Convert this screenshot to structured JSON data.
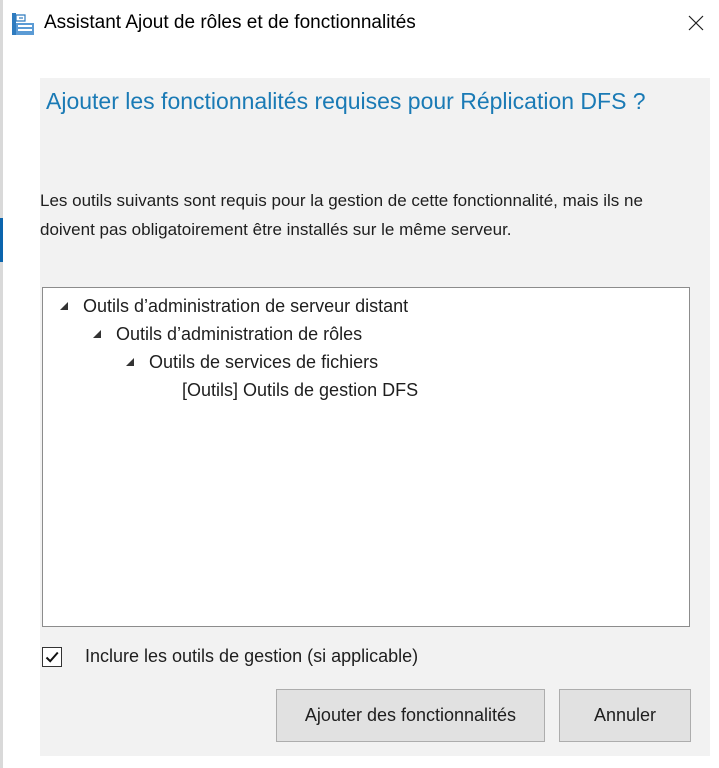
{
  "window": {
    "title": "Assistant Ajout de rôles et de fonctionnalités",
    "close_icon": "close-icon",
    "app_icon": "server-manager-icon"
  },
  "dialog": {
    "heading": "Ajouter les fonctionnalités requises pour Réplication DFS ?",
    "description": "Les outils suivants sont requis pour la gestion de cette fonctionnalité, mais ils ne doivent pas obligatoirement être installés sur le même serveur.",
    "tree": [
      {
        "label": "Outils d’administration de serveur distant",
        "level": 0,
        "expanded": true
      },
      {
        "label": "Outils d’administration de rôles",
        "level": 1,
        "expanded": true
      },
      {
        "label": "Outils de services de fichiers",
        "level": 2,
        "expanded": true
      },
      {
        "label": "[Outils] Outils de gestion DFS",
        "level": 3,
        "expanded": null
      }
    ],
    "include_tools": {
      "label": "Inclure les outils de gestion (si applicable)",
      "checked": true
    },
    "buttons": {
      "add": "Ajouter des fonctionnalités",
      "cancel": "Annuler"
    }
  },
  "colors": {
    "heading": "#1a7ab5",
    "panel_background": "#f2f2f2",
    "button_background": "#e1e1e1",
    "accent": "#0a64ad"
  }
}
